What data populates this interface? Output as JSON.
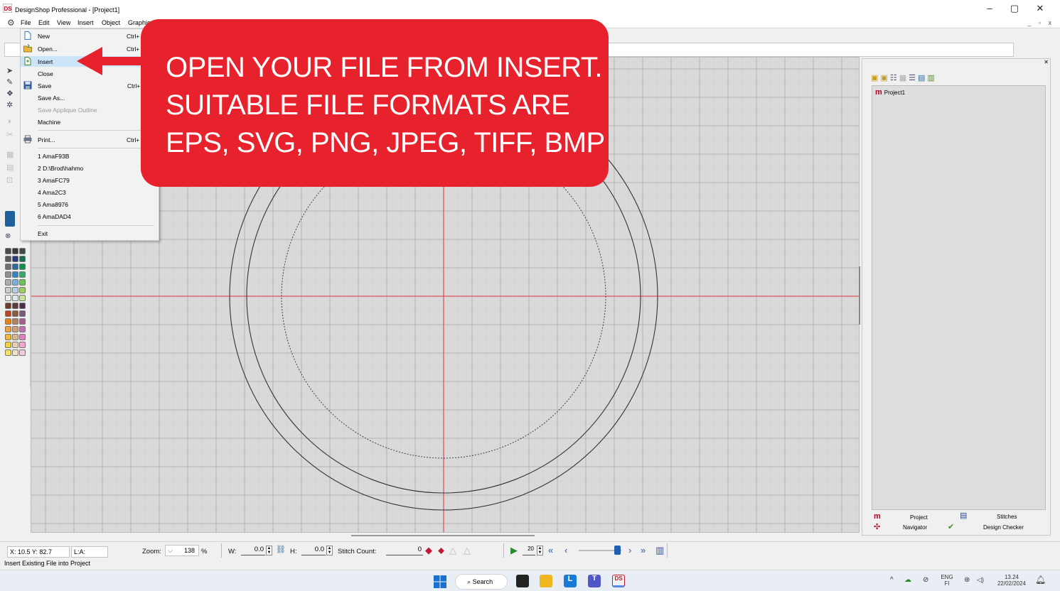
{
  "window": {
    "title": "DesignShop Professional - [Project1]",
    "minimize": "–",
    "maximize": "▢",
    "close": "✕",
    "mdi_controls": "_ ▫ x"
  },
  "menubar": {
    "items": [
      "File",
      "Edit",
      "View",
      "Insert",
      "Object",
      "Graphic"
    ]
  },
  "file_menu": {
    "new": {
      "label": "New",
      "shortcut": "Ctrl+"
    },
    "open": {
      "label": "Open...",
      "shortcut": "Ctrl+"
    },
    "insert": {
      "label": "Insert"
    },
    "close": {
      "label": "Close"
    },
    "save": {
      "label": "Save",
      "shortcut": "Ctrl+"
    },
    "save_as": {
      "label": "Save As..."
    },
    "save_applique": {
      "label": "Save Applique Outline"
    },
    "machine": {
      "label": "Machine"
    },
    "print": {
      "label": "Print...",
      "shortcut": "Ctrl+"
    },
    "recent": [
      "1 AmaF93B",
      "2 D:\\Brod\\hahmo",
      "3 AmaFC79",
      "4 Ama2C3",
      "5 Ama8976",
      "6 AmaDAD4"
    ],
    "exit": {
      "label": "Exit"
    }
  },
  "callout": {
    "lines": [
      "OPEN YOUR FILE FROM INSERT.",
      "SUITABLE FILE FORMATS ARE",
      "EPS, SVG, PNG, JPEG, TIFF, BMP"
    ],
    "color": "#e8222d"
  },
  "palette": {
    "colors": [
      [
        "#4a4a4a",
        "#3a3a3a",
        "#3c4c48"
      ],
      [
        "#5a5a5a",
        "#2d3a7a",
        "#1e6a4e"
      ],
      [
        "#6c7070",
        "#2e6aa0",
        "#1a8a4a"
      ],
      [
        "#8c9090",
        "#3b84c4",
        "#3aa86a"
      ],
      [
        "#a8acac",
        "#7ab0d8",
        "#6cc05a"
      ],
      [
        "#c8cccc",
        "#b0d0e8",
        "#9ad060"
      ],
      [
        "#ececec",
        "#dce8f0",
        "#c8e4a0"
      ],
      [
        "#6a3e2a",
        "#5a3a3a",
        "#4a2e4a"
      ],
      [
        "#c04020",
        "#8a5a40",
        "#7a5a7a"
      ],
      [
        "#e88020",
        "#b08060",
        "#a06090"
      ],
      [
        "#f0a040",
        "#c8a080",
        "#c070b0"
      ],
      [
        "#f0b840",
        "#d8b890",
        "#e080c0"
      ],
      [
        "#f0d040",
        "#e8d0b0",
        "#f0a8d0"
      ],
      [
        "#f8e060",
        "#f0e0c8",
        "#f8c8e0"
      ]
    ],
    "current_color": "#1f5f9e"
  },
  "right_panel": {
    "tree_root": "Project1",
    "tabs": [
      "Project",
      "Stitches",
      "Navigator",
      "Design Checker"
    ]
  },
  "status": {
    "coords": "X: 10.5  Y: 82.7",
    "layer": "L:A:",
    "zoom_label": "Zoom:",
    "zoom_value": "138",
    "zoom_unit": "%",
    "w_label": "W:",
    "w_value": "0.0",
    "h_label": "H:",
    "h_value": "0.0",
    "stitch_label": "Stitch Count:",
    "stitch_value": "0",
    "speed_value": "20",
    "hint": "Insert Existing File into Project"
  },
  "taskbar": {
    "search": "Search",
    "lang": "ENG",
    "region": "FI",
    "time": "13.24",
    "date": "22/02/2024"
  }
}
